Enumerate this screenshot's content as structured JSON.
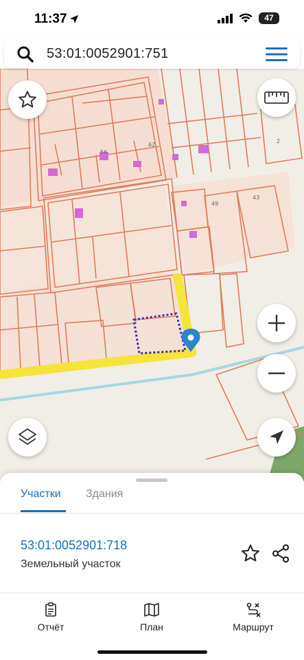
{
  "status": {
    "time": "11:37",
    "battery": "47"
  },
  "search": {
    "query": "53:01:0052901:751"
  },
  "map": {
    "house_numbers": [
      "56",
      "62",
      "2",
      "49",
      "43"
    ]
  },
  "sheet": {
    "tabs": [
      {
        "label": "Участки",
        "active": true
      },
      {
        "label": "Здания",
        "active": false
      }
    ],
    "parcel": {
      "number": "53:01:0052901:718",
      "type": "Земельный участок"
    }
  },
  "bottom_nav": {
    "report": "Отчёт",
    "plan": "План",
    "route": "Маршрут"
  },
  "colors": {
    "accent": "#1a6fb8",
    "parcel_border": "#e07b5a",
    "building": "#d36bd6",
    "road_highlight": "#f5e43a",
    "selection": "#3b2fb5"
  },
  "icons": [
    "location-arrow-icon",
    "signal-icon",
    "wifi-icon",
    "battery-icon",
    "search-icon",
    "menu-icon",
    "star-icon",
    "ruler-icon",
    "plus-icon",
    "minus-icon",
    "layers-icon",
    "navigate-icon",
    "map-pin-icon",
    "share-icon",
    "report-icon",
    "map-icon",
    "route-icon"
  ]
}
